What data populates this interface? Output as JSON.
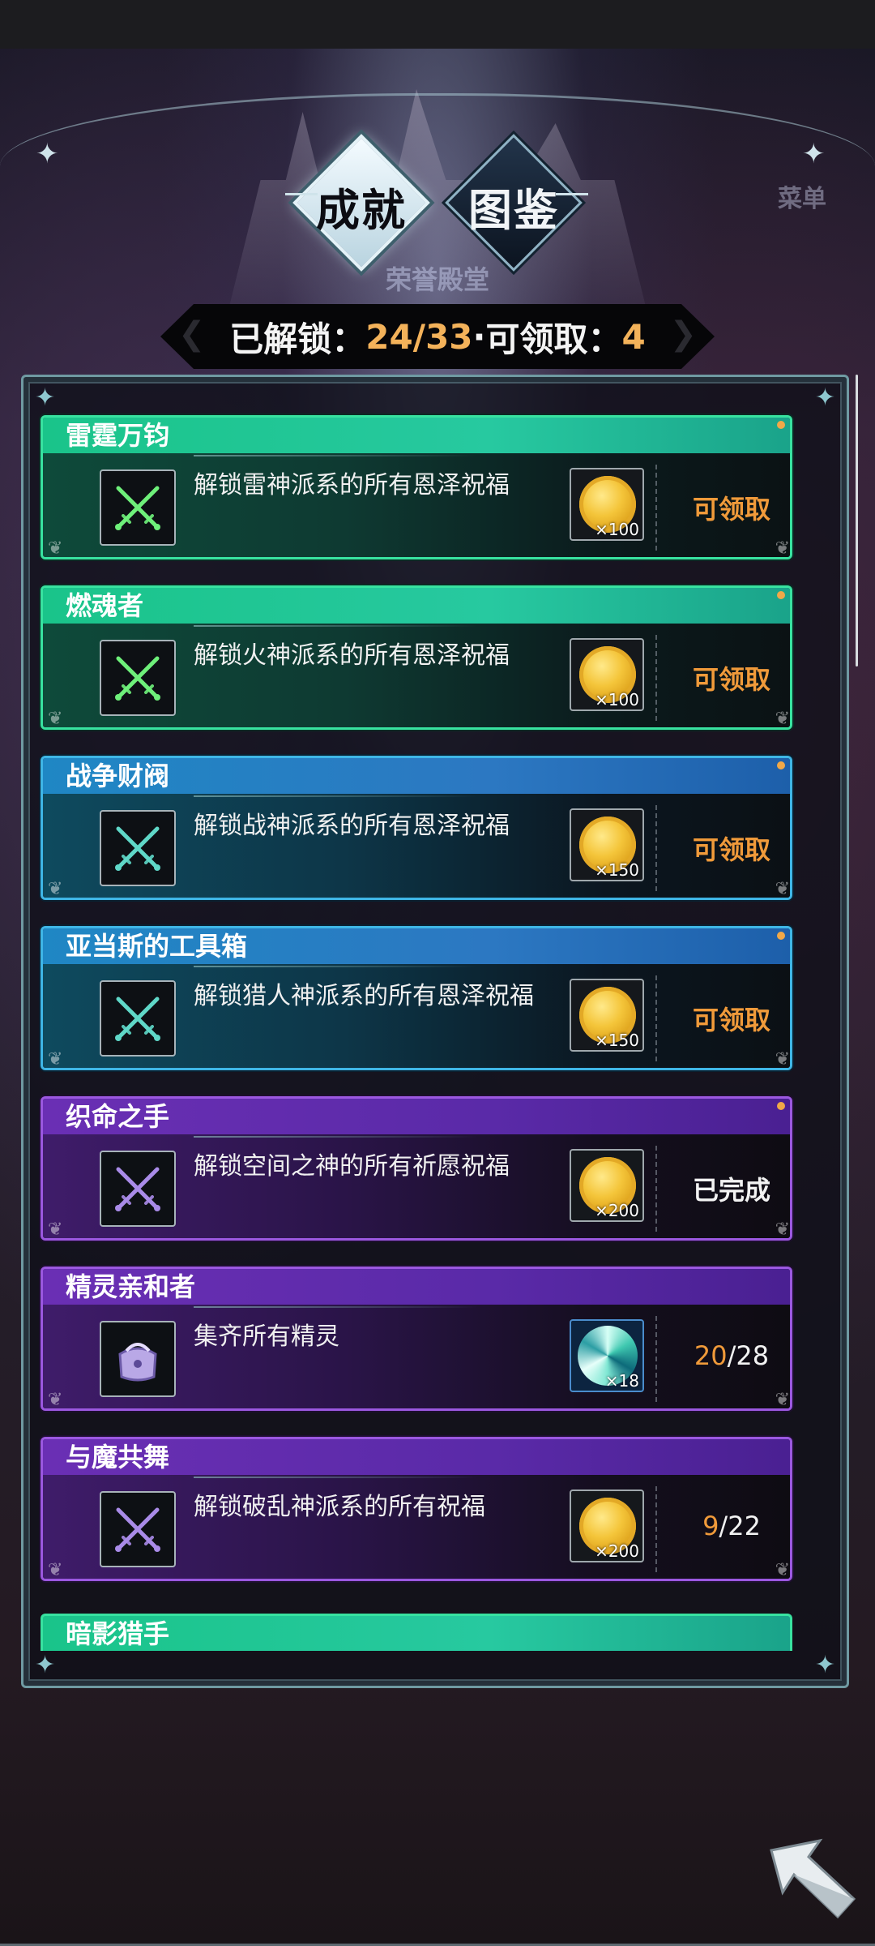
{
  "tabs": [
    {
      "label": "成就",
      "active": true
    },
    {
      "label": "图鉴",
      "active": false
    }
  ],
  "hall_label": "荣誉殿堂",
  "menu_label": "菜单",
  "counter": {
    "unlocked_label": "已解锁：",
    "unlocked": "24",
    "separator": "/",
    "total": "33",
    "dot": " · ",
    "claimable_label": "可领取：",
    "claimable": "4"
  },
  "achievements": [
    {
      "title": "雷霆万钧",
      "desc": "解锁雷神派系的所有恩泽祝福",
      "reward_icon": "gold-coin-icon",
      "reward_qty": "×100",
      "status": "可领取",
      "state": "claimable",
      "theme": "green",
      "sword_color": "#6ef07a",
      "badge": true
    },
    {
      "title": "燃魂者",
      "desc": "解锁火神派系的所有恩泽祝福",
      "reward_icon": "gold-coin-icon",
      "reward_qty": "×100",
      "status": "可领取",
      "state": "claimable",
      "theme": "green",
      "sword_color": "#6ef07a",
      "badge": true
    },
    {
      "title": "战争财阀",
      "desc": "解锁战神派系的所有恩泽祝福",
      "reward_icon": "gold-coin-icon",
      "reward_qty": "×150",
      "status": "可领取",
      "state": "claimable",
      "theme": "blue",
      "sword_color": "#5fd8c8",
      "badge": true
    },
    {
      "title": "亚当斯的工具箱",
      "desc": "解锁猎人神派系的所有恩泽祝福",
      "reward_icon": "gold-coin-icon",
      "reward_qty": "×150",
      "status": "可领取",
      "state": "claimable",
      "theme": "blue",
      "sword_color": "#5fd8c8",
      "badge": true
    },
    {
      "title": "织命之手",
      "desc": "解锁空间之神的所有祈愿祝福",
      "reward_icon": "gold-coin-icon",
      "reward_qty": "×200",
      "status": "已完成",
      "state": "done",
      "theme": "purple",
      "sword_color": "#a98be8",
      "badge": true
    },
    {
      "title": "精灵亲和者",
      "desc": "集齐所有精灵",
      "reward_icon": "spirit-swirl-icon",
      "reward_qty": "×18",
      "status_current": "20",
      "status_total": "/28",
      "state": "progress",
      "theme": "purple",
      "item_icon": "pouch-icon",
      "badge": false
    },
    {
      "title": "与魔共舞",
      "desc": "解锁破乱神派系的所有祝福",
      "reward_icon": "gold-coin-icon",
      "reward_qty": "×200",
      "status_current": "9",
      "status_total": "/22",
      "state": "progress",
      "theme": "purple",
      "sword_color": "#a98be8",
      "badge": false
    }
  ],
  "partial_card": {
    "title": "暗影猎手",
    "theme": "green"
  },
  "colors": {
    "gold": "#f3b25a",
    "claim_orange": "#f09a3a",
    "green": "#27c9a0",
    "blue": "#2c78c2",
    "purple": "#6a2fb4"
  }
}
